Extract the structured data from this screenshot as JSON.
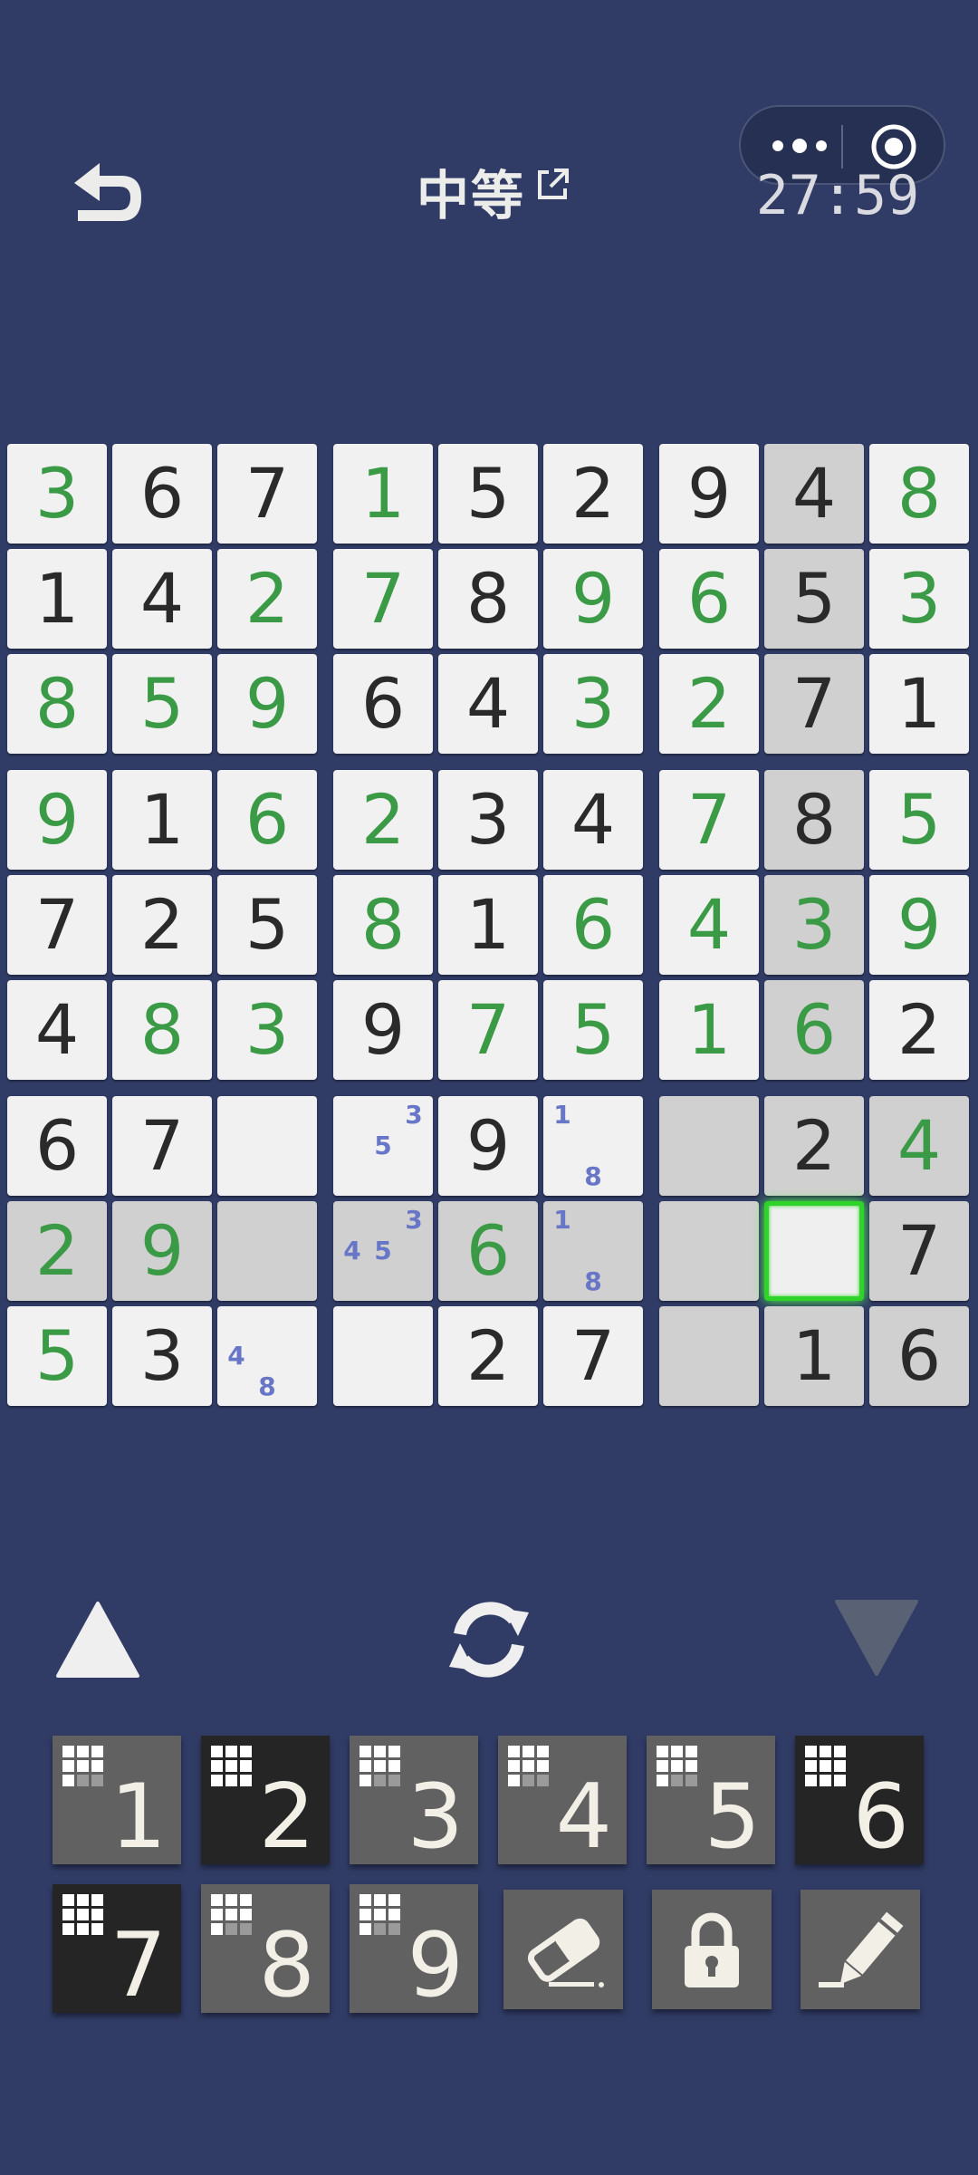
{
  "header": {
    "title": "中等",
    "timer": "27:59",
    "back_icon": "back-arrow-icon",
    "external_icon": "external-link-icon",
    "capsule_more_icon": "more-dots-icon",
    "capsule_close_icon": "target-circle-icon"
  },
  "board": {
    "rows": [
      [
        "3",
        "6",
        "7",
        "1",
        "5",
        "2",
        "9",
        "4",
        "8"
      ],
      [
        "1",
        "4",
        "2",
        "7",
        "8",
        "9",
        "6",
        "5",
        "3"
      ],
      [
        "8",
        "5",
        "9",
        "6",
        "4",
        "3",
        "2",
        "7",
        "1"
      ],
      [
        "9",
        "1",
        "6",
        "2",
        "3",
        "4",
        "7",
        "8",
        "5"
      ],
      [
        "7",
        "2",
        "5",
        "8",
        "1",
        "6",
        "4",
        "3",
        "9"
      ],
      [
        "4",
        "8",
        "3",
        "9",
        "7",
        "5",
        "1",
        "6",
        "2"
      ],
      [
        "6",
        "7",
        "",
        "",
        "9",
        "",
        "",
        "2",
        "4"
      ],
      [
        "2",
        "9",
        "",
        "",
        "6",
        "",
        "",
        "",
        "7"
      ],
      [
        "5",
        "3",
        "",
        "",
        "2",
        "7",
        "",
        "1",
        "6"
      ]
    ],
    "kinds": [
      [
        "u",
        "g",
        "g",
        "u",
        "g",
        "g",
        "g",
        "g",
        "u"
      ],
      [
        "g",
        "g",
        "u",
        "u",
        "g",
        "u",
        "u",
        "g",
        "u"
      ],
      [
        "u",
        "u",
        "u",
        "g",
        "g",
        "u",
        "u",
        "g",
        "g"
      ],
      [
        "u",
        "g",
        "u",
        "u",
        "g",
        "g",
        "u",
        "g",
        "u"
      ],
      [
        "g",
        "g",
        "g",
        "u",
        "g",
        "u",
        "u",
        "u",
        "u"
      ],
      [
        "g",
        "u",
        "u",
        "g",
        "u",
        "u",
        "u",
        "u",
        "g"
      ],
      [
        "g",
        "g",
        "",
        "",
        "g",
        "",
        "",
        "g",
        "u"
      ],
      [
        "u",
        "u",
        "",
        "",
        "u",
        "",
        "",
        "",
        "g"
      ],
      [
        "u",
        "g",
        "",
        "",
        "g",
        "g",
        "",
        "g",
        "g"
      ]
    ],
    "notes": [
      [
        6,
        3,
        [
          "",
          "",
          "3",
          "",
          "5",
          "",
          "",
          "",
          ""
        ]
      ],
      [
        6,
        5,
        [
          "1",
          "",
          "",
          "",
          "",
          "",
          "",
          "8",
          ""
        ]
      ],
      [
        7,
        3,
        [
          "",
          "",
          "3",
          "4",
          "5",
          "",
          "",
          "",
          ""
        ]
      ],
      [
        7,
        5,
        [
          "1",
          "",
          "",
          "",
          "",
          "",
          "",
          "8",
          ""
        ]
      ],
      [
        8,
        2,
        [
          "",
          "",
          "",
          "4",
          "",
          "",
          "",
          "8",
          ""
        ]
      ]
    ],
    "highlighted_cells": [
      [
        0,
        7
      ],
      [
        1,
        7
      ],
      [
        2,
        7
      ],
      [
        3,
        7
      ],
      [
        4,
        7
      ],
      [
        5,
        7
      ],
      [
        6,
        6
      ],
      [
        6,
        7
      ],
      [
        6,
        8
      ],
      [
        7,
        6
      ],
      [
        7,
        8
      ],
      [
        8,
        6
      ],
      [
        8,
        7
      ],
      [
        8,
        8
      ],
      [
        7,
        0
      ],
      [
        7,
        1
      ],
      [
        7,
        2
      ],
      [
        7,
        3
      ],
      [
        7,
        4
      ],
      [
        7,
        5
      ]
    ],
    "selected_cell": [
      7,
      7
    ],
    "colors": {
      "given": "#2a2a2a",
      "user": "#3b9a46",
      "note": "#6776c6",
      "selected_border": "#2fd32a",
      "background": "#313c66"
    }
  },
  "controls": {
    "prev_icon": "triangle-up-icon",
    "refresh_icon": "refresh-icon",
    "next_icon": "triangle-down-icon"
  },
  "keypad": {
    "keys": [
      {
        "label": "1",
        "dark": false,
        "remaining": 0.25
      },
      {
        "label": "2",
        "dark": true,
        "remaining": 0.0
      },
      {
        "label": "3",
        "dark": false,
        "remaining": 0.25
      },
      {
        "label": "4",
        "dark": false,
        "remaining": 0.25
      },
      {
        "label": "5",
        "dark": false,
        "remaining": 0.25
      },
      {
        "label": "6",
        "dark": true,
        "remaining": 0.0
      },
      {
        "label": "7",
        "dark": true,
        "remaining": 0.0
      },
      {
        "label": "8",
        "dark": false,
        "remaining": 0.25
      },
      {
        "label": "9",
        "dark": false,
        "remaining": 0.25
      }
    ],
    "tools": [
      {
        "icon": "eraser-icon"
      },
      {
        "icon": "lock-icon"
      },
      {
        "icon": "pencil-icon"
      }
    ]
  }
}
